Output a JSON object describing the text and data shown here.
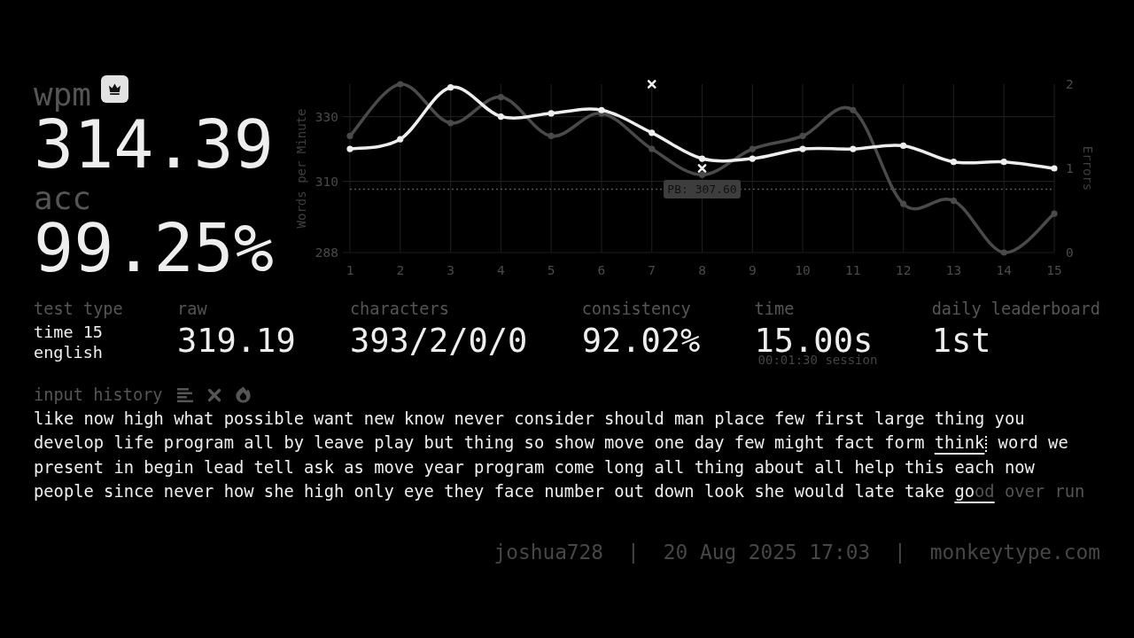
{
  "result": {
    "wpm": {
      "label": "wpm",
      "value": "314.39",
      "personal_best": true
    },
    "acc": {
      "label": "acc",
      "value": "99.25%"
    }
  },
  "chart": {
    "chart_data": {
      "type": "line",
      "ylabel": "Words per Minute",
      "y2label": "Errors",
      "x": [
        1,
        2,
        3,
        4,
        5,
        6,
        7,
        8,
        9,
        10,
        11,
        12,
        13,
        14,
        15
      ],
      "xlim": [
        1,
        15
      ],
      "xticks": [
        1,
        2,
        3,
        4,
        5,
        6,
        7,
        8,
        9,
        10,
        11,
        12,
        13,
        14,
        15
      ],
      "ylim": [
        288,
        340
      ],
      "yticks": [
        288,
        310,
        330
      ],
      "y2lim": [
        0,
        2
      ],
      "y2ticks": [
        0,
        1,
        2
      ],
      "grid": true,
      "series": [
        {
          "color": "#4a4a4a",
          "marker": "circle",
          "values": [
            324,
            340,
            328,
            336,
            324,
            331,
            320,
            312,
            320,
            324,
            332,
            303,
            304,
            288,
            300
          ]
        },
        {
          "color": "#eeeeee",
          "marker": "circle",
          "values": [
            320,
            323,
            339,
            330,
            331,
            332,
            325,
            317,
            317,
            320,
            320,
            321,
            316,
            316,
            314
          ]
        },
        {
          "type": "scatter",
          "axis": "y2",
          "color": "#eeeeee",
          "marker": "x",
          "values": [
            null,
            null,
            null,
            null,
            null,
            null,
            2,
            1,
            null,
            null,
            null,
            null,
            null,
            null,
            null
          ]
        }
      ],
      "ref_lines": [
        {
          "axis": "y",
          "value": 307.6,
          "label": "PB: 307.60",
          "color": "#555555",
          "line_style": "dotted"
        }
      ]
    }
  },
  "stats": [
    {
      "label": "test type",
      "kind": "lines",
      "lines": [
        "time 15",
        "english"
      ]
    },
    {
      "label": "raw",
      "kind": "value",
      "value": "319.19"
    },
    {
      "label": "characters",
      "kind": "value",
      "value": "393/2/0/0"
    },
    {
      "label": "consistency",
      "kind": "value",
      "value": "92.02%"
    },
    {
      "label": "time",
      "kind": "value",
      "value": "15.00s",
      "note": "00:01:30 session"
    },
    {
      "label": "daily leaderboard",
      "kind": "value",
      "value": "1st"
    }
  ],
  "input_history": {
    "title": "input history",
    "tools": [
      {
        "kind": "bars"
      },
      {
        "kind": "close"
      },
      {
        "kind": "flame"
      }
    ],
    "lines": [
      [
        {
          "text": "like now high what possible want new know never consider should man place few first large thing you",
          "kind": "correct"
        }
      ],
      [
        {
          "text": "develop life program all by leave play but thing so show move one day few might fact form ",
          "kind": "correct"
        },
        {
          "text": "think",
          "kind": "error"
        },
        {
          "kind": "marker"
        },
        {
          "text": " word we",
          "kind": "correct"
        }
      ],
      [
        {
          "text": "present in begin lead tell ask as move year program come long all thing about all help this each now",
          "kind": "correct"
        }
      ],
      [
        {
          "text": "people since never how she high only eye they face number out down look she would late take ",
          "kind": "correct"
        },
        {
          "text": "go",
          "kind": "error"
        },
        {
          "text": "od",
          "kind": "missed"
        },
        {
          "text": " over run",
          "kind": "untyped"
        }
      ]
    ]
  },
  "footer": [
    "joshua728",
    "|",
    "20 Aug 2025 17:03",
    "|",
    "monkeytype.com"
  ]
}
